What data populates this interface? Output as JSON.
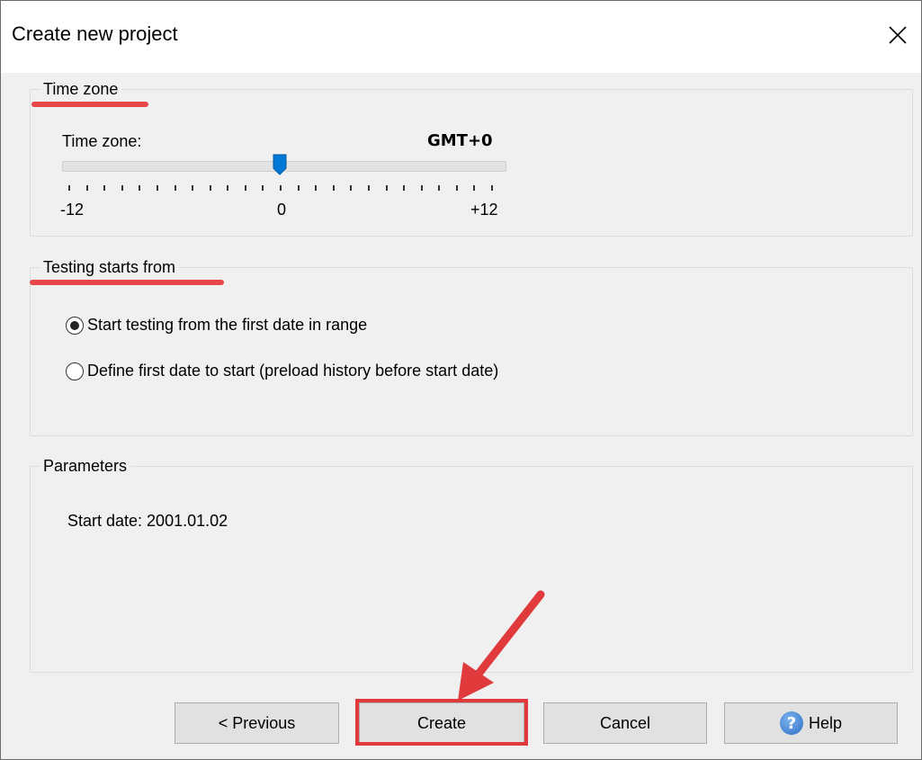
{
  "window": {
    "title": "Create new project"
  },
  "time_zone_group": {
    "legend": "Time zone",
    "label": "Time zone:",
    "value": "GMT+0",
    "slider": {
      "min": -12,
      "max": 12,
      "value": 0
    },
    "tick_labels": {
      "min": "-12",
      "mid": "0",
      "max": "+12"
    }
  },
  "testing_group": {
    "legend": "Testing starts from",
    "options": [
      {
        "label": "Start testing from the first date in range",
        "checked": true
      },
      {
        "label": "Define first date to start (preload history before start date)",
        "checked": false
      }
    ]
  },
  "parameters_group": {
    "legend": "Parameters",
    "start_date": "Start date: 2001.01.02"
  },
  "buttons": {
    "previous": "< Previous",
    "create": "Create",
    "cancel": "Cancel",
    "help": "Help"
  },
  "icons": {
    "close": "close-icon",
    "help": "help-icon"
  },
  "colors": {
    "annotation": "#e8474a",
    "slider_thumb": "#0078d7"
  }
}
